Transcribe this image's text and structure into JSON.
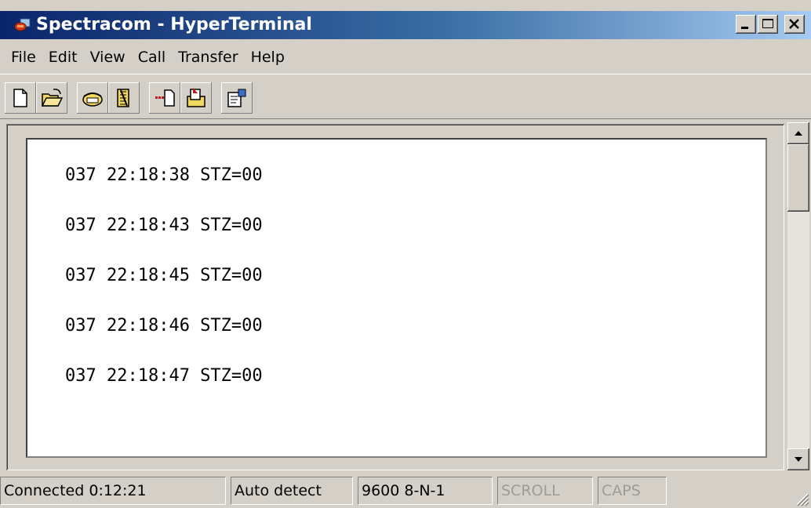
{
  "window": {
    "title": "Spectracom - HyperTerminal",
    "icon": "hyperterminal-app-icon",
    "controls": [
      "minimize-icon",
      "maximize-icon",
      "close-icon"
    ]
  },
  "menu": {
    "items": [
      {
        "label": "File"
      },
      {
        "label": "Edit"
      },
      {
        "label": "View"
      },
      {
        "label": "Call"
      },
      {
        "label": "Transfer"
      },
      {
        "label": "Help"
      }
    ]
  },
  "toolbar": {
    "buttons": [
      "new-icon",
      "open-icon",
      "call-icon",
      "disconnect-icon",
      "send-icon",
      "receive-icon",
      "properties-icon"
    ]
  },
  "terminal": {
    "lines": [
      "037 22:18:38 STZ=00",
      "037 22:18:43 STZ=00",
      "037 22:18:45 STZ=00",
      "037 22:18:46 STZ=00",
      "037 22:18:47 STZ=00"
    ]
  },
  "status": {
    "connected": "Connected 0:12:21",
    "detect": "Auto detect",
    "settings": "9600 8-N-1",
    "scroll": "SCROLL",
    "caps": "CAPS"
  },
  "colors": {
    "titlebar_start": "#0a246a",
    "titlebar_end": "#a6caf0",
    "face": "#d4d0c8"
  }
}
